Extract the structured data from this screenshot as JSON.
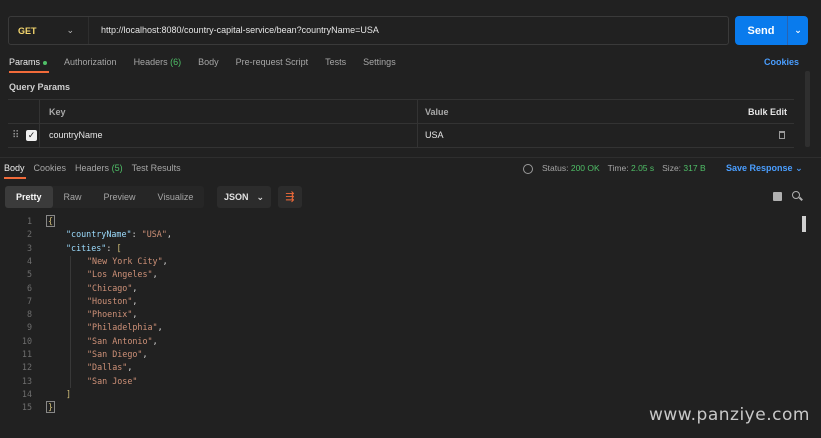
{
  "request": {
    "method": "GET",
    "url": "http://localhost:8080/country-capital-service/bean?countryName=USA",
    "send_label": "Send"
  },
  "request_tabs": [
    {
      "label": "Params",
      "active": true
    },
    {
      "label": "Authorization"
    },
    {
      "label": "Headers",
      "count": "(6)"
    },
    {
      "label": "Body"
    },
    {
      "label": "Pre-request Script"
    },
    {
      "label": "Tests"
    },
    {
      "label": "Settings"
    }
  ],
  "cookies_link": "Cookies",
  "query_params": {
    "title": "Query Params",
    "headers": {
      "key": "Key",
      "value": "Value",
      "bulk_edit": "Bulk Edit"
    },
    "rows": [
      {
        "key": "countryName",
        "value": "USA",
        "checked": true
      }
    ]
  },
  "response_tabs": [
    {
      "label": "Body",
      "active": true
    },
    {
      "label": "Cookies"
    },
    {
      "label": "Headers",
      "count": "(5)"
    },
    {
      "label": "Test Results"
    }
  ],
  "status": {
    "status_label": "Status:",
    "status_value": "200 OK",
    "time_label": "Time:",
    "time_value": "2.05 s",
    "size_label": "Size:",
    "size_value": "317 B"
  },
  "save_response": "Save Response",
  "view_modes": [
    "Pretty",
    "Raw",
    "Preview",
    "Visualize"
  ],
  "format": "JSON",
  "code_lines": [
    "1",
    "2",
    "3",
    "4",
    "5",
    "6",
    "7",
    "8",
    "9",
    "10",
    "11",
    "12",
    "13",
    "14",
    "15"
  ],
  "json_body": {
    "country_key": "\"countryName\"",
    "country_val": "\"USA\"",
    "cities_key": "\"cities\"",
    "cities": [
      "\"New York City\"",
      "\"Los Angeles\"",
      "\"Chicago\"",
      "\"Houston\"",
      "\"Phoenix\"",
      "\"Philadelphia\"",
      "\"San Antonio\"",
      "\"San Diego\"",
      "\"Dallas\"",
      "\"San Jose\""
    ]
  },
  "watermark": "www.panziye.com",
  "colors": {
    "accent_orange": "#f26b3a",
    "send_blue": "#097bed",
    "status_green": "#4fbf67",
    "method_yellow": "#f5d76e"
  }
}
